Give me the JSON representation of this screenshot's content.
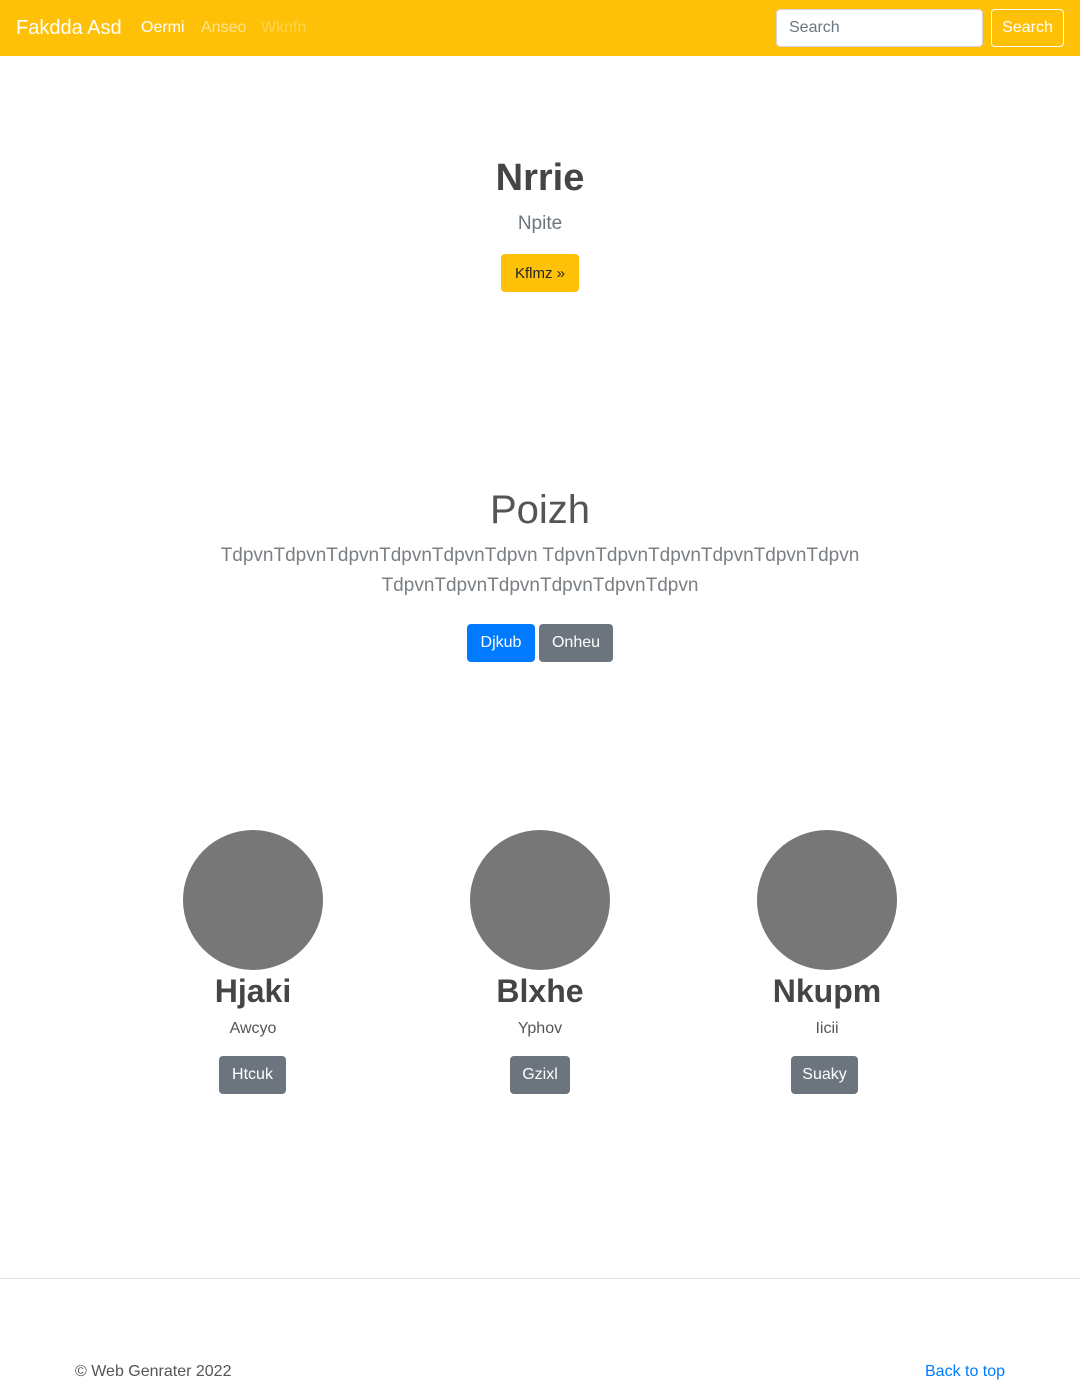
{
  "navbar": {
    "brand": "Fakdda Asd",
    "links": [
      "Oermi",
      "Anseo",
      "Wknfn"
    ],
    "search": {
      "placeholder": "Search",
      "button_label": "Search"
    },
    "background_color": "#ffc107"
  },
  "hero": {
    "title": "Nrrie",
    "subtitle": "Npite",
    "button_label": "Kflmz »"
  },
  "section": {
    "title": "Poizh",
    "text": "TdpvnTdpvnTdpvnTdpvnTdpvnTdpvn TdpvnTdpvnTdpvnTdpvnTdpvnTdpvn TdpvnTdpvnTdpvnTdpvnTdpvnTdpvn",
    "primary_button": "Djkub",
    "secondary_button": "Onheu"
  },
  "cards": [
    {
      "name": "Hjaki",
      "subtitle": "Awcyo",
      "button_label": "Htcuk"
    },
    {
      "name": "Blxhe",
      "subtitle": "Yphov",
      "button_label": "Gzixl"
    },
    {
      "name": "Nkupm",
      "subtitle": "Iicii",
      "button_label": "Suaky"
    }
  ],
  "footer": {
    "copyright": "© Web Genrater 2022",
    "back_to_top": "Back to top"
  }
}
